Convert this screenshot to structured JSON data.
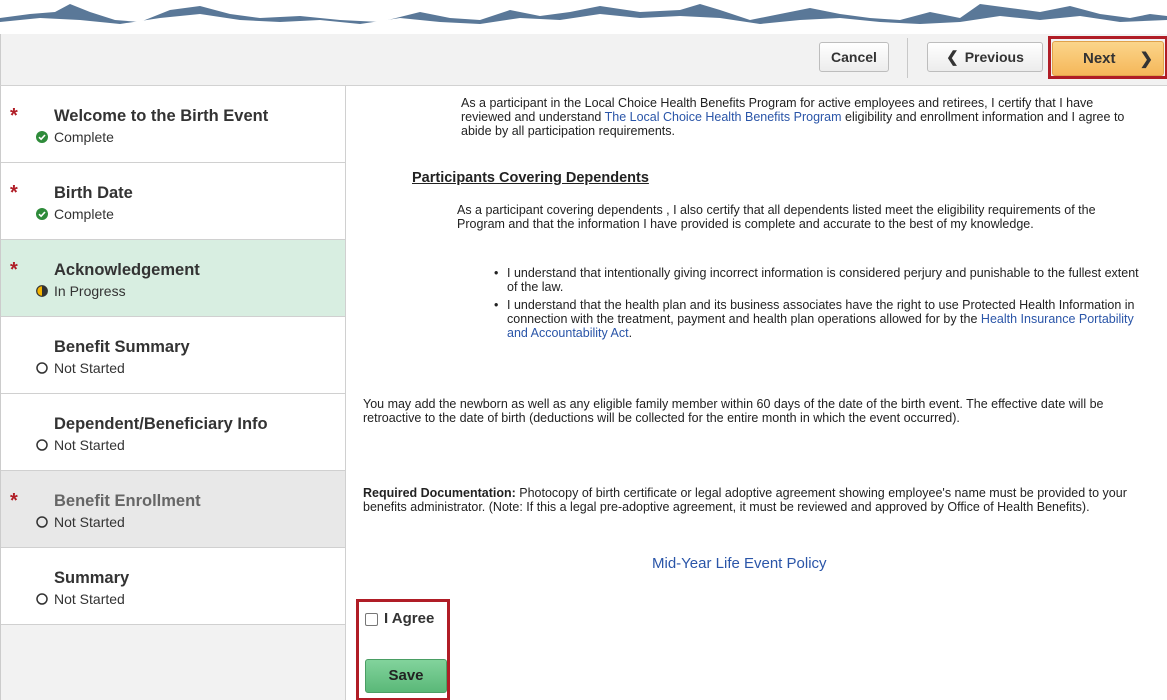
{
  "toolbar": {
    "cancel_label": "Cancel",
    "previous_label": "Previous",
    "next_label": "Next",
    "previous_icon": "chevron-left-icon",
    "next_icon": "chevron-right-icon"
  },
  "sidebar": {
    "items": [
      {
        "title": "Welcome to the Birth Event",
        "status": "Complete",
        "required": "*",
        "state": "complete"
      },
      {
        "title": "Birth Date",
        "status": "Complete",
        "required": "*",
        "state": "complete"
      },
      {
        "title": "Acknowledgement",
        "status": "In Progress",
        "required": "*",
        "state": "in-progress"
      },
      {
        "title": "Benefit Summary",
        "status": "Not Started",
        "required": "",
        "state": "not-started"
      },
      {
        "title": "Dependent/Beneficiary Info",
        "status": "Not Started",
        "required": "",
        "state": "not-started"
      },
      {
        "title": "Benefit Enrollment",
        "status": "Not Started",
        "required": "*",
        "state": "not-started"
      },
      {
        "title": "Summary",
        "status": "Not Started",
        "required": "",
        "state": "not-started"
      }
    ]
  },
  "main": {
    "p1_before": "As a participant in the Local Choice Health Benefits Program for active employees and retirees, I certify that I have reviewed and understand ",
    "p1_link": "The Local Choice Health Benefits Program",
    "p1_after": " eligibility and enrollment information and I agree to abide by all participation requirements.",
    "dependents_heading": "Participants Covering Dependents",
    "p2": "As a participant covering dependents , I also certify that all dependents listed meet the eligibility requirements of the Program and that the information I have provided is complete and accurate to the best of my knowledge.",
    "bullet1": "I understand that intentionally giving incorrect information is considered perjury and punishable to the fullest extent of the law.",
    "bullet2_before": "I understand that the health plan and its business associates have the right to use Protected Health Information in connection with the treatment, payment and health plan operations allowed for by the ",
    "bullet2_link": "Health Insurance Portability and Accountability Act",
    "bullet2_after": ".",
    "p3": "You may add  the newborn as well as any eligible family member within 60 days of the date of the birth event. The effective date will be retroactive to the date of birth (deductions will be collected for the entire month in which the event occurred).",
    "p4_label": "Required Documentation:",
    "p4_text": " Photocopy of birth certificate or legal adoptive agreement showing employee's name must be provided to your benefits administrator. (Note: If this a legal pre-adoptive agreement, it must be reviewed and approved by Office of Health Benefits).",
    "policy_link": "Mid-Year Life Event Policy",
    "agree_label": "I Agree",
    "save_label": "Save"
  },
  "colors": {
    "required_star": "#b01d26",
    "complete": "#2e8b3a",
    "active_step_bg": "#d8eee1",
    "next_button": "#f5b75a",
    "save_button": "#5ab878",
    "highlight_box": "#b01d26",
    "link": "#2a55a8"
  }
}
